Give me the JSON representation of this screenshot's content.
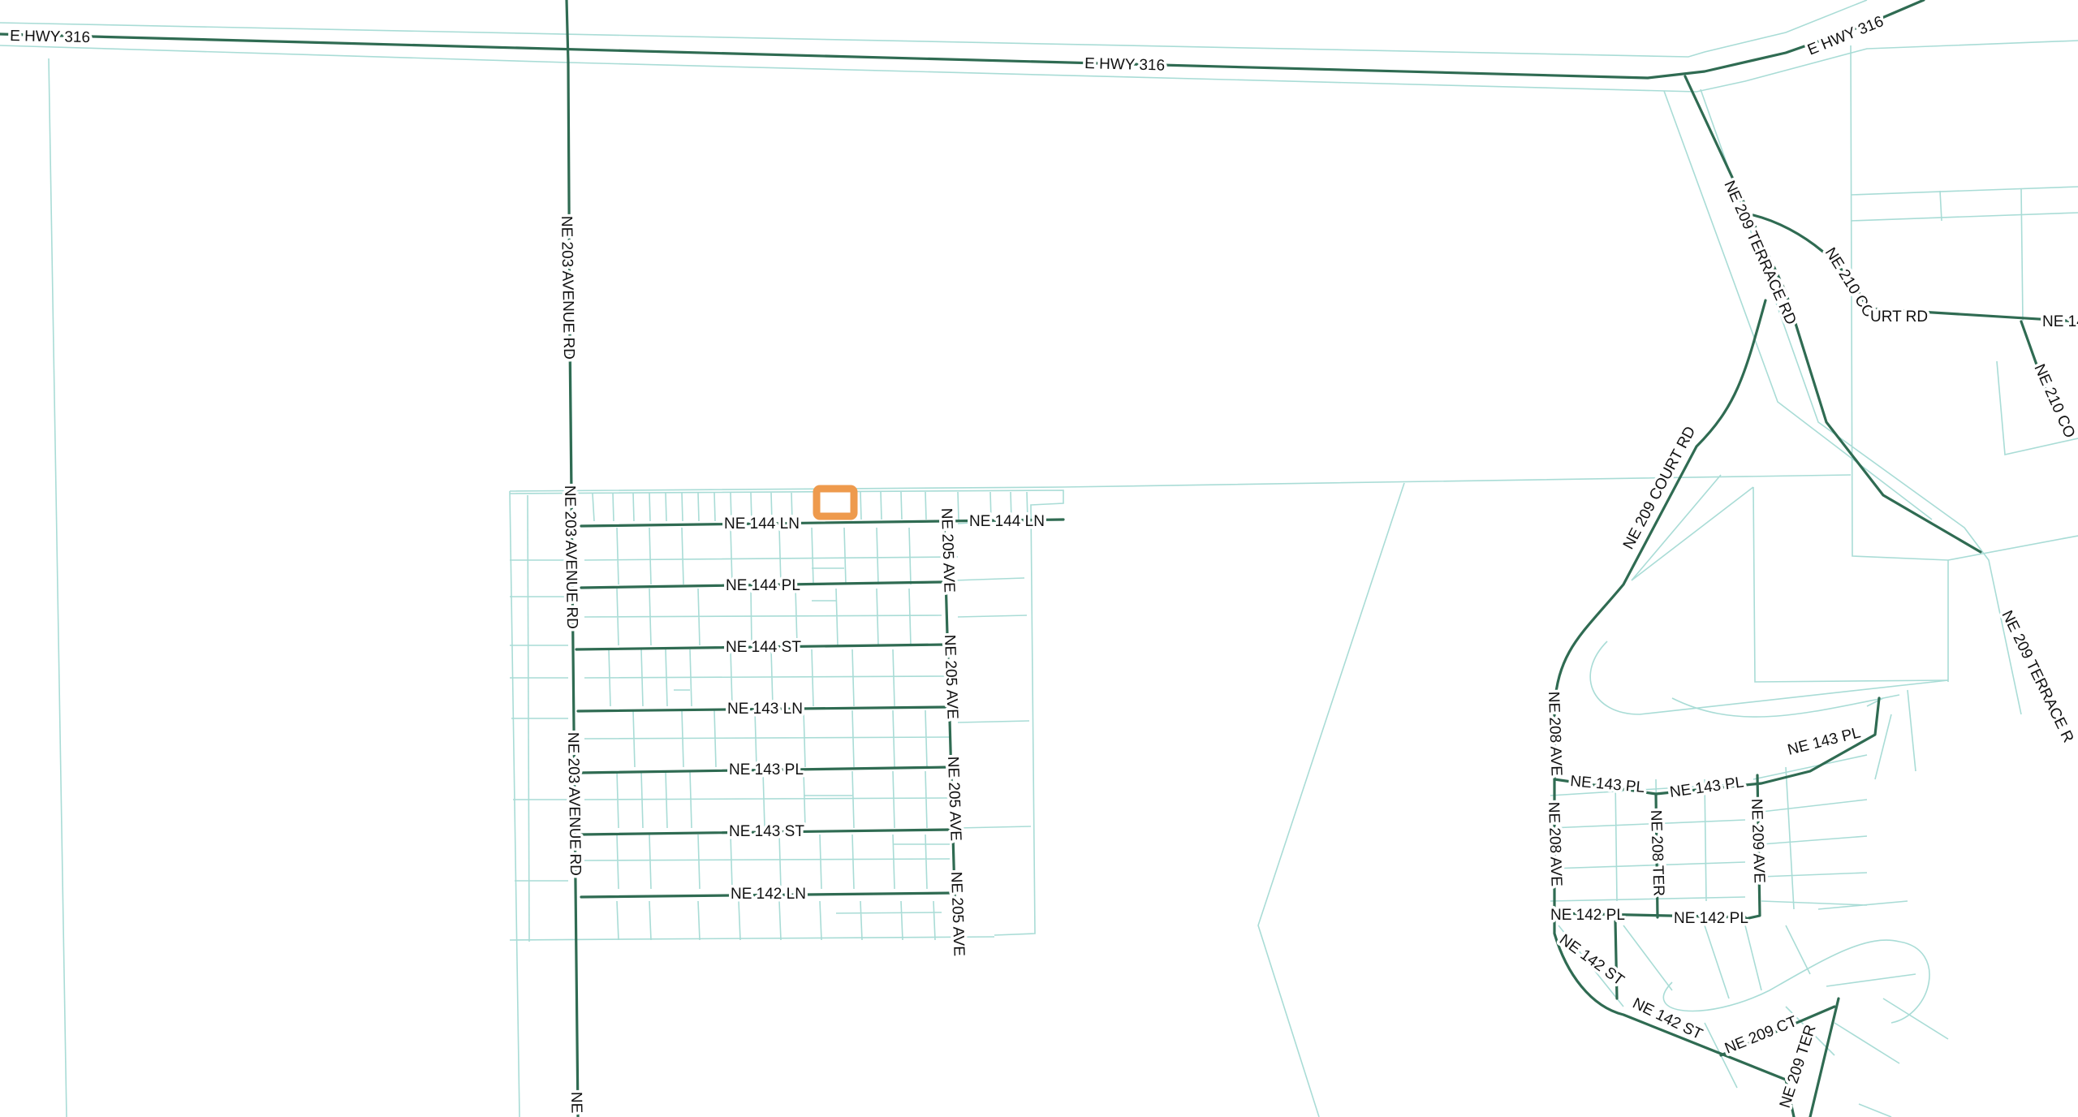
{
  "map": {
    "highlight_color": "#ee9a4d",
    "road_color": "#2f6b52",
    "parcel_color": "#a9dcd6",
    "background": "#ffffff"
  },
  "labels": {
    "hwy_left": "E HWY 316",
    "hwy_mid": "E HWY 316",
    "hwy_right": "E HWY 316",
    "ne203_top": "NE 203 AVENUE RD",
    "ne203_mid": "NE 203 AVENUE RD",
    "ne203_low": "NE 203 AVENUE RD",
    "ne203_cut": "NE",
    "ne144ln_a": "NE 144 LN",
    "ne144ln_b": "NE 144 LN",
    "ne144pl": "NE 144 PL",
    "ne144st": "NE 144 ST",
    "ne143ln": "NE 143 LN",
    "ne143pl": "NE 143 PL",
    "ne143st": "NE 143 ST",
    "ne142ln": "NE 142 LN",
    "ne205_a": "NE 205 AVE",
    "ne205_b": "NE 205 AVE",
    "ne205_c": "NE 205 AVE",
    "ne205_d": "NE 205 AVE",
    "ne209terrace_a": "NE 209 TERRACE RD",
    "ne209terrace_b": "NE 209 TERRACE R",
    "ne210court_a": "NE 210 CO",
    "ne210court_b": "URT RD",
    "ne14x": "NE 14",
    "ne210co_side": "NE 210 CO",
    "ne209court": "NE 209 COURT RD",
    "ne208ave_a": "NE 208 AVE",
    "ne208ave_b": "NE 208 AVE",
    "ne143pl_e1": "NE 143 PL",
    "ne143pl_e2": "NE 143 PL",
    "ne143pl_e3": "NE 143 PL",
    "ne208ter": "NE 208 TER",
    "ne209ave": "NE 209 AVE",
    "ne142pl_a": "NE 142 PL",
    "ne142pl_b": "NE 142 PL",
    "ne142st_a": "NE 142 ST",
    "ne142st_b": "NE 142 ST",
    "ne209ct": "NE 209 CT",
    "ne209ter": "NE 209 TER"
  }
}
